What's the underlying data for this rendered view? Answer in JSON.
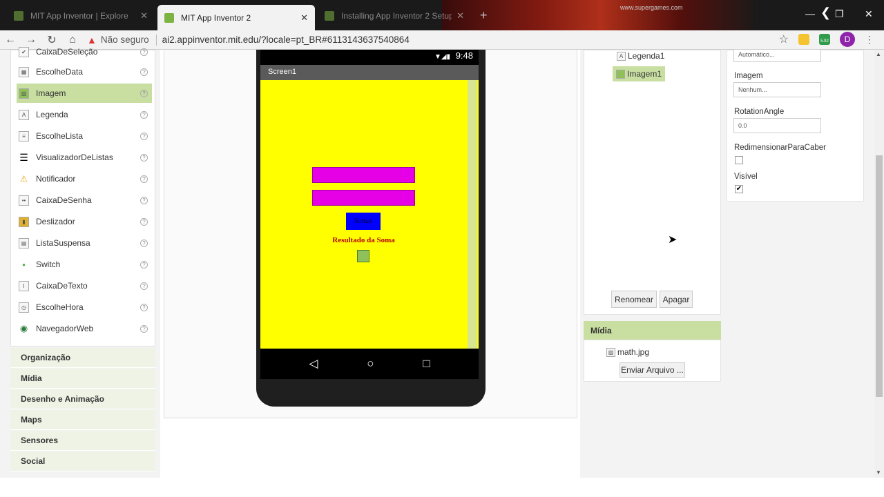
{
  "browser": {
    "tabs": [
      {
        "title": "MIT App Inventor | Explore",
        "state": "inactive"
      },
      {
        "title": "MIT App Inventor 2",
        "state": "active"
      },
      {
        "title": "Installing App Inventor 2 Setup",
        "state": "inactive"
      }
    ],
    "close_glyph": "✕",
    "watermark": "www.supergames.com",
    "security_label": "Não seguro",
    "url": "ai2.appinventor.mit.edu/?locale=pt_BR#6113143637540864",
    "profile_initial": "D",
    "ext_badge": "5.92"
  },
  "palette": {
    "partial_top_item": "CaixaDeSeleção",
    "items": [
      {
        "label": "EscolheData",
        "icon": "date-picker-icon",
        "glyph": "▦"
      },
      {
        "label": "Imagem",
        "icon": "image-icon",
        "glyph": "▨",
        "selected": true
      },
      {
        "label": "Legenda",
        "icon": "label-icon",
        "glyph": "A"
      },
      {
        "label": "EscolheLista",
        "icon": "list-picker-icon",
        "glyph": "≡"
      },
      {
        "label": "VisualizadorDeListas",
        "icon": "list-view-icon",
        "glyph": "☰"
      },
      {
        "label": "Notificador",
        "icon": "notifier-icon",
        "glyph": "⚠"
      },
      {
        "label": "CaixaDeSenha",
        "icon": "password-box-icon",
        "glyph": "••"
      },
      {
        "label": "Deslizador",
        "icon": "slider-icon",
        "glyph": "▮"
      },
      {
        "label": "ListaSuspensa",
        "icon": "spinner-icon",
        "glyph": "▤"
      },
      {
        "label": "Switch",
        "icon": "switch-icon",
        "glyph": "●"
      },
      {
        "label": "CaixaDeTexto",
        "icon": "textbox-icon",
        "glyph": "I"
      },
      {
        "label": "EscolheHora",
        "icon": "time-picker-icon",
        "glyph": "◷"
      },
      {
        "label": "NavegadorWeb",
        "icon": "web-viewer-icon",
        "glyph": "◉"
      }
    ],
    "help_glyph": "?",
    "categories": [
      "Organização",
      "Mídia",
      "Desenho e Animação",
      "Maps",
      "Sensores",
      "Social"
    ]
  },
  "viewer": {
    "time": "9:48",
    "screen_title": "Screen1",
    "button_text": "Somar",
    "result_label": "Resultado da Soma",
    "colors": {
      "screen": "#ffff00",
      "textbox": "#e600e6",
      "button": "#0000ff",
      "label": "#b8000a"
    }
  },
  "components": {
    "items": [
      {
        "label": "Legenda1",
        "icon": "label-icon"
      },
      {
        "label": "Imagem1",
        "icon": "image-icon",
        "selected": true
      }
    ],
    "rename_label": "Renomear",
    "delete_label": "Apagar"
  },
  "media": {
    "title": "Mídia",
    "files": [
      "math.jpg"
    ],
    "upload_label": "Enviar Arquivo ..."
  },
  "properties": {
    "partial_top_value": "Automático...",
    "image_label": "Imagem",
    "image_value": "Nenhum...",
    "rotation_label": "RotationAngle",
    "rotation_value": "0.0",
    "scale_label": "RedimensionarParaCaber",
    "scale_checked": false,
    "visible_label": "Visível",
    "visible_checked": true
  }
}
